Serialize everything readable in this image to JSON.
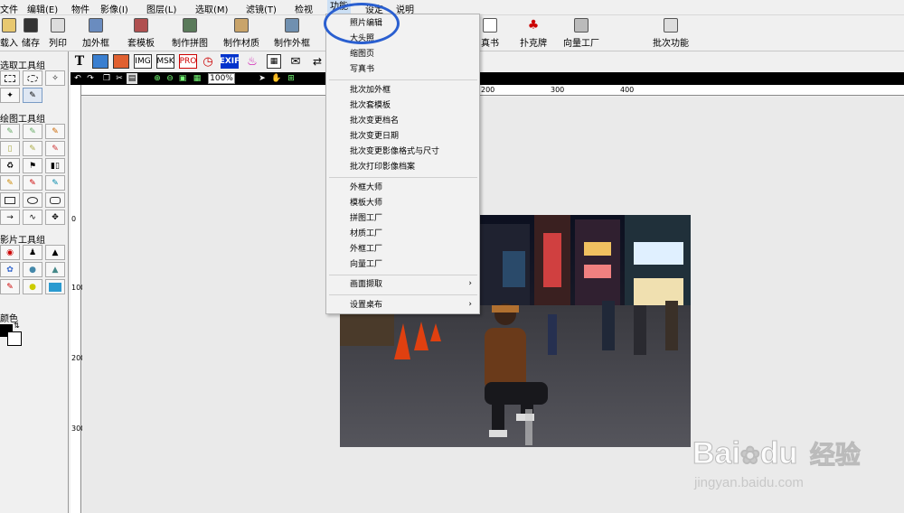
{
  "menubar": {
    "items": [
      "文件",
      "编辑(E)",
      "物件",
      "影像(I)",
      "图层(L)",
      "选取(M)",
      "滤镜(T)",
      "检视",
      "功能",
      "设定",
      "说明"
    ]
  },
  "toolbar": {
    "buttons": [
      "载入",
      "储存",
      "列印",
      "加外框",
      "套模板",
      "制作拼图",
      "制作材质",
      "制作外框",
      "真书",
      "扑克牌",
      "向量工厂",
      "批次功能"
    ]
  },
  "toolbox": {
    "select_group": "选取工具组",
    "draw_group": "绘图工具组",
    "photo_group": "影片工具组",
    "color_label": "颜色"
  },
  "image_toolbar": {
    "text_tool": "T",
    "labels": [
      "IMG",
      "MSK",
      "PRO",
      "EXIF"
    ]
  },
  "viewbar": {
    "zoom": "100%"
  },
  "rulers": {
    "h_ticks": [
      "200",
      "300",
      "400"
    ],
    "v_ticks": [
      "0",
      "100",
      "200",
      "300"
    ]
  },
  "dropdown": {
    "items": [
      "照片编辑",
      "大头照",
      "缩图页",
      "写真书",
      "批次加外框",
      "批次套模板",
      "批次变更档名",
      "批次变更日期",
      "批次变更影像格式与尺寸",
      "批次打印影像档案",
      "外框大师",
      "模板大师",
      "拼图工厂",
      "材质工厂",
      "外框工厂",
      "向量工厂",
      "画面撷取",
      "设置桌布"
    ]
  },
  "watermark": {
    "brand": "Bai",
    "brand_tail": "du",
    "brand_cn": "经验",
    "url": "jingyan.baidu.com"
  },
  "colors": {
    "highlight": "#2a5fd0",
    "menu_active": "#cce0f5"
  }
}
